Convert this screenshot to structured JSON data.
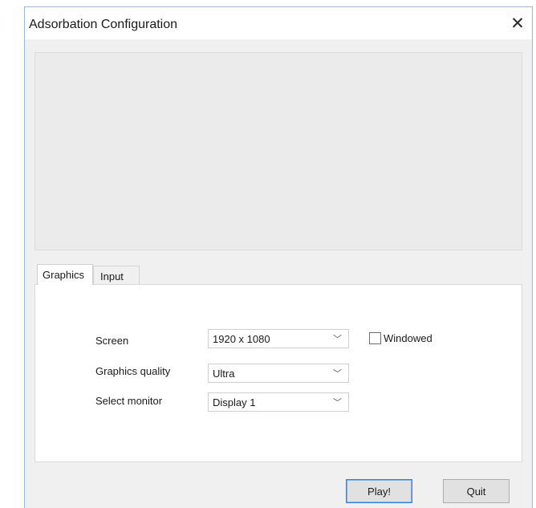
{
  "window": {
    "title": "Adsorbation Configuration",
    "close_glyph": "✕"
  },
  "tabs": [
    {
      "label": "Graphics",
      "active": true
    },
    {
      "label": "Input",
      "active": false
    }
  ],
  "graphics": {
    "screen": {
      "label": "Screen",
      "value": "1920 x 1080"
    },
    "quality": {
      "label": "Graphics quality",
      "value": "Ultra"
    },
    "monitor": {
      "label": "Select monitor",
      "value": "Display 1"
    },
    "windowed": {
      "label": "Windowed",
      "checked": false
    },
    "chevron": "﹀"
  },
  "buttons": {
    "play": "Play!",
    "quit": "Quit"
  },
  "colors": {
    "window_bg": "#f0f0f0",
    "title_bg": "#ffffff",
    "accent_border": "#3c7fd1"
  }
}
